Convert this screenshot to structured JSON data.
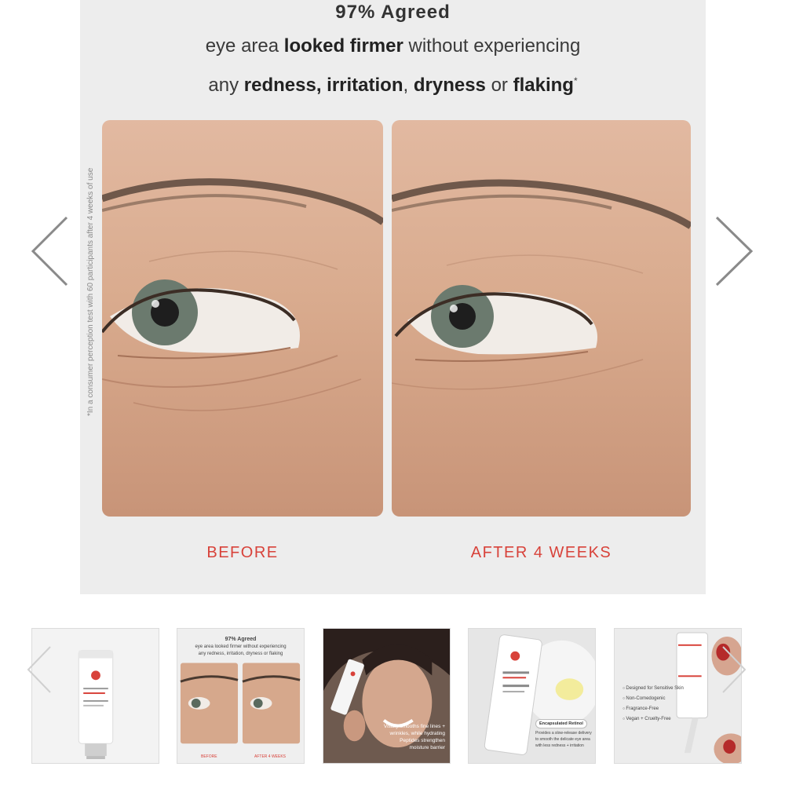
{
  "slide": {
    "headline": "97% Agreed",
    "line1_pre": "eye area ",
    "line1_bold": "looked firmer",
    "line1_post": " without experiencing",
    "line2_pre": "any ",
    "line2_bold1": "redness, irritation",
    "line2_sep1": ", ",
    "line2_bold2": "dryness",
    "line2_sep2": " or ",
    "line2_bold3": "flaking",
    "line2_mark": "*",
    "footnote": "*In a consumer perception test with 60 participants after 4 weeks of use",
    "before_label": "BEFORE",
    "after_label": "AFTER 4 WEEKS"
  },
  "nav": {
    "prev_icon": "chevron-left-icon",
    "next_icon": "chevron-right-icon"
  },
  "thumbnails": {
    "t2": {
      "title": "97% Agreed",
      "sub": "eye area looked firmer without experiencing",
      "sub2": "any redness, irritation, dryness or flaking",
      "before": "BEFORE",
      "after": "AFTER 4 WEEKS"
    },
    "t3": {
      "line1": "Visibly smooths fine lines +",
      "line2": "wrinkles, while hydrating",
      "line3": "Peptides strengthen",
      "line4": "moisture barrier"
    },
    "t4": {
      "badge": "Encapsulated Retinol",
      "l1": "Provides a slow-release delivery",
      "l2": "to smooth the delicate eye area",
      "l3": "with less redness + irritation"
    },
    "t5": {
      "items": [
        "Designed for Sensitive Skin",
        "Non-Comedogenic",
        "Fragrance-Free",
        "Vegan + Cruelty-Free"
      ]
    }
  },
  "colors": {
    "accent": "#d8423a",
    "panel_bg": "#ededed"
  }
}
